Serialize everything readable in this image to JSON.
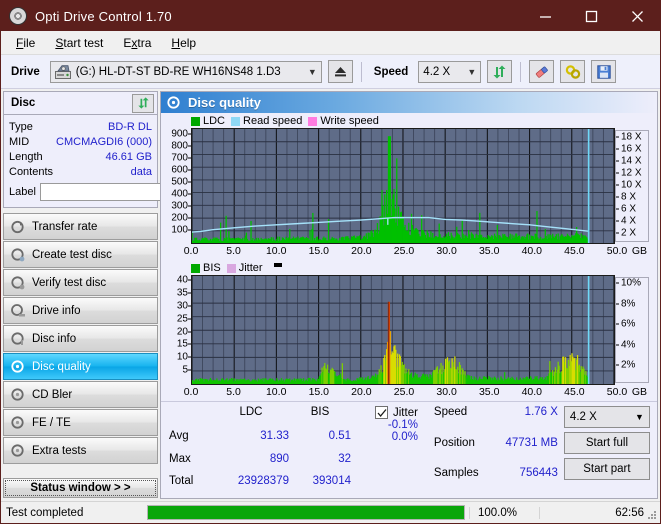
{
  "window": {
    "title": "Opti Drive Control 1.70",
    "app_icon": "disc-icon",
    "minimize": "minimize-icon",
    "maximize": "maximize-icon",
    "close": "close-icon",
    "accent_titlebar": "#5c1f1c"
  },
  "menu": [
    {
      "label": "File",
      "accel": "F"
    },
    {
      "label": "Start test",
      "accel": "S"
    },
    {
      "label": "Extra",
      "accel": "x"
    },
    {
      "label": "Help",
      "accel": "H"
    }
  ],
  "toolbar": {
    "drive_label": "Drive",
    "drive_value": "(G:)  HL-DT-ST BD-RE  WH16NS48 1.D3",
    "eject_icon": "eject-icon",
    "speed_label": "Speed",
    "speed_value": "4.2 X",
    "refresh_icon": "refresh-icon",
    "erase_icon": "eraser-icon",
    "settings_icon": "gears-icon",
    "save_icon": "floppy-save-icon"
  },
  "disc_panel": {
    "title": "Disc",
    "refresh_icon": "refresh-icon",
    "rows": [
      {
        "key": "Type",
        "value": "BD-R DL"
      },
      {
        "key": "MID",
        "value": "CMCMAGDI6 (000)"
      },
      {
        "key": "Length",
        "value": "46.61 GB"
      },
      {
        "key": "Contents",
        "value": "data"
      }
    ],
    "label_key": "Label",
    "label_value": "",
    "label_placeholder": "",
    "label_button_icon": "disc-icon"
  },
  "nav": {
    "items": [
      {
        "label": "Transfer rate",
        "icon": "disc-transfer-icon",
        "active": false
      },
      {
        "label": "Create test disc",
        "icon": "disc-create-icon",
        "active": false
      },
      {
        "label": "Verify test disc",
        "icon": "disc-verify-icon",
        "active": false
      },
      {
        "label": "Drive info",
        "icon": "disc-drive-icon",
        "active": false
      },
      {
        "label": "Disc info",
        "icon": "disc-info-icon",
        "active": false
      },
      {
        "label": "Disc quality",
        "icon": "disc-quality-icon",
        "active": true
      },
      {
        "label": "CD Bler",
        "icon": "disc-bler-icon",
        "active": false
      },
      {
        "label": "FE / TE",
        "icon": "disc-fete-icon",
        "active": false
      },
      {
        "label": "Extra tests",
        "icon": "disc-extra-icon",
        "active": false
      }
    ],
    "status_window_label": "Status window > >"
  },
  "content": {
    "header_title": "Disc quality",
    "header_icon": "disc-quality-icon"
  },
  "chart_data": [
    {
      "id": "ldc-chart",
      "type": "area",
      "title": "Disc quality",
      "legend": [
        {
          "label": "LDC",
          "color": "#00a800"
        },
        {
          "label": "Read speed",
          "color": "#8fd8f5"
        },
        {
          "label": "Write speed",
          "color": "#ff7ce0"
        }
      ],
      "legend_position": "top-left",
      "grid": true,
      "xlabel": "GB",
      "xlim": [
        0,
        50
      ],
      "xticks": [
        0.0,
        5.0,
        10.0,
        15.0,
        20.0,
        25.0,
        30.0,
        35.0,
        40.0,
        45.0,
        50.0
      ],
      "xticklabels": [
        "0.0",
        "5.0",
        "10.0",
        "15.0",
        "20.0",
        "25.0",
        "30.0",
        "35.0",
        "40.0",
        "45.0",
        "50.0"
      ],
      "ylabel": "",
      "ylim": [
        0,
        950
      ],
      "yticks": [
        100,
        200,
        300,
        400,
        500,
        600,
        700,
        800,
        900
      ],
      "yticklabels": [
        "100",
        "200",
        "300",
        "400",
        "500",
        "600",
        "700",
        "800",
        "900"
      ],
      "y2lim": [
        0,
        19
      ],
      "y2ticks": [
        2,
        4,
        6,
        8,
        10,
        12,
        14,
        16,
        18
      ],
      "y2ticklabels": [
        "2 X",
        "4 X",
        "6 X",
        "8 X",
        "10 X",
        "12 X",
        "14 X",
        "16 X",
        "18 X"
      ],
      "data_end_gb": 47.0,
      "series": [
        {
          "name": "LDC",
          "color": "#00c000",
          "baseline_x": [
            0,
            2,
            5,
            8,
            11,
            14,
            17,
            20,
            21.5,
            22.5,
            23.4,
            24.2,
            25.2,
            26.5,
            28,
            30,
            33,
            36,
            39,
            42,
            45,
            47
          ],
          "baseline_y": [
            40,
            45,
            45,
            48,
            48,
            50,
            52,
            60,
            100,
            230,
            560,
            300,
            180,
            130,
            95,
            80,
            78,
            75,
            72,
            70,
            72,
            70
          ],
          "peak_x": 23.4,
          "peak_y": 890
        },
        {
          "name": "Read speed",
          "color": "#a5e2fa",
          "x": [
            0,
            1,
            2.5,
            5,
            7.5,
            10,
            12.5,
            15,
            17.5,
            20,
            22,
            24,
            26,
            28,
            30,
            32,
            34,
            36,
            38,
            40,
            42,
            44,
            46,
            47
          ],
          "y_x_units": [
            1.9,
            2.0,
            2.3,
            2.6,
            2.9,
            3.1,
            3.3,
            3.5,
            3.7,
            3.9,
            4.1,
            4.3,
            4.3,
            4.3,
            4.0,
            3.9,
            3.7,
            3.5,
            3.3,
            3.1,
            2.8,
            2.5,
            2.2,
            2.05
          ]
        }
      ]
    },
    {
      "id": "bis-chart",
      "type": "area",
      "legend": [
        {
          "label": "BIS",
          "color": "#00a800"
        },
        {
          "label": "Jitter",
          "color": "#d9a8e0"
        }
      ],
      "legend_position": "top-left",
      "grid": true,
      "xlabel": "GB",
      "xlim": [
        0,
        50
      ],
      "xticks": [
        0.0,
        5.0,
        10.0,
        15.0,
        20.0,
        25.0,
        30.0,
        35.0,
        40.0,
        45.0,
        50.0
      ],
      "xticklabels": [
        "0.0",
        "5.0",
        "10.0",
        "15.0",
        "20.0",
        "25.0",
        "30.0",
        "35.0",
        "40.0",
        "45.0",
        "50.0"
      ],
      "ylim": [
        0,
        42
      ],
      "yticks": [
        5,
        10,
        15,
        20,
        25,
        30,
        35,
        40
      ],
      "yticklabels": [
        "5",
        "10",
        "15",
        "20",
        "25",
        "30",
        "35",
        "40"
      ],
      "y2lim": [
        0,
        10.5
      ],
      "y2ticks": [
        2,
        4,
        6,
        8,
        10
      ],
      "y2ticklabels": [
        "2%",
        "4%",
        "6%",
        "8%",
        "10%"
      ],
      "data_end_gb": 47.0,
      "series": [
        {
          "name": "BIS",
          "color_low": "#00c000",
          "color_mid": "#d8e000",
          "color_high": "#e85c00",
          "baseline_x": [
            0,
            3,
            6,
            9,
            12,
            15,
            15.8,
            18,
            20.5,
            21.8,
            22.6,
            23.3,
            24.0,
            25.0,
            26.2,
            28,
            30.8,
            33,
            36,
            39,
            42,
            44.2,
            45.6,
            47
          ],
          "baseline_y": [
            2.0,
            2.1,
            2.0,
            2.0,
            2.0,
            2.1,
            9.0,
            2.2,
            2.4,
            3.5,
            8.0,
            21.0,
            13.0,
            7.0,
            4.2,
            3.2,
            10.0,
            2.8,
            2.6,
            2.6,
            2.8,
            9.6,
            9.8,
            3.0
          ],
          "peak_x": 23.3,
          "peak_y": 32
        }
      ]
    }
  ],
  "stats": {
    "columns": [
      "LDC",
      "BIS"
    ],
    "rows": [
      {
        "label": "Avg",
        "ldc": "31.33",
        "bis": "0.51"
      },
      {
        "label": "Max",
        "ldc": "890",
        "bis": "32"
      },
      {
        "label": "Total",
        "ldc": "23928379",
        "bis": "393014"
      }
    ],
    "jitter": {
      "checked": true,
      "label": "Jitter",
      "avg": "-0.1%",
      "max": "0.0%"
    },
    "speed_label": "Speed",
    "speed_value": "1.76 X",
    "position_label": "Position",
    "position_value": "47731 MB",
    "samples_label": "Samples",
    "samples_value": "756443",
    "speed_select": "4.2 X",
    "start_full_label": "Start full",
    "start_part_label": "Start part"
  },
  "statusbar": {
    "text": "Test completed",
    "progress_percent": 100.0,
    "progress_label": "100.0%",
    "elapsed": "62:56"
  }
}
